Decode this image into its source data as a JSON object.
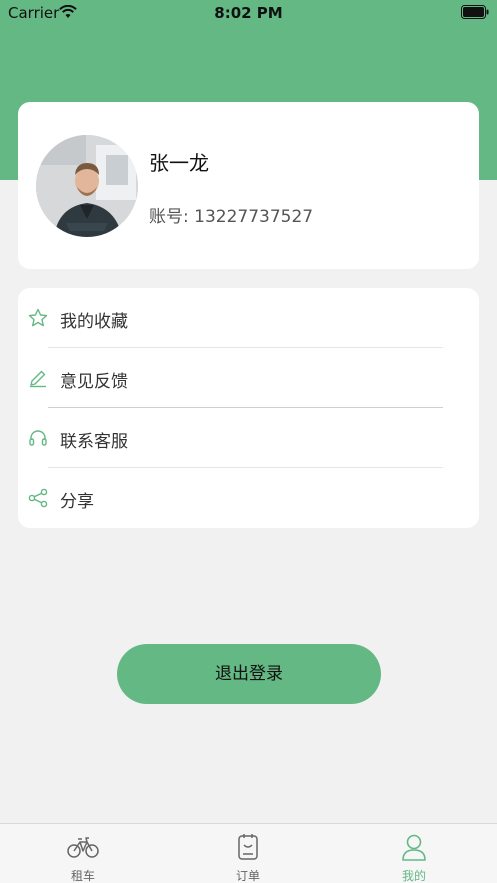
{
  "status_bar": {
    "carrier": "Carrier",
    "time": "8:02 PM"
  },
  "colors": {
    "brand": "#63b884",
    "background": "#f1f1f1"
  },
  "profile": {
    "name": "张一龙",
    "account": "账号: 13227737527"
  },
  "menu": {
    "items": [
      {
        "icon": "star-icon",
        "label": "我的收藏"
      },
      {
        "icon": "pencil-icon",
        "label": "意见反馈"
      },
      {
        "icon": "headset-icon",
        "label": "联系客服"
      },
      {
        "icon": "share-icon",
        "label": "分享"
      }
    ]
  },
  "logout_label": "退出登录",
  "tabs": [
    {
      "icon": "bicycle-icon",
      "label": "租车",
      "active": false
    },
    {
      "icon": "order-icon",
      "label": "订单",
      "active": false
    },
    {
      "icon": "person-icon",
      "label": "我的",
      "active": true
    }
  ]
}
